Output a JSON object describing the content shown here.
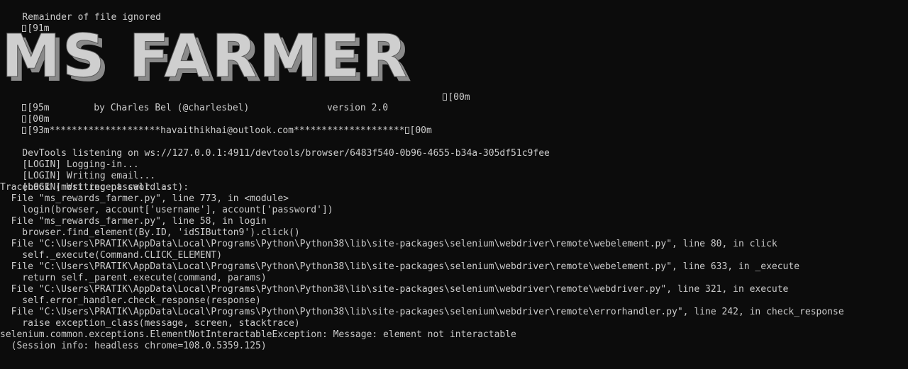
{
  "terminal": {
    "notice": "Remainder of file ignored",
    "ansi_red": "[91m",
    "banner_text": "MS FARMER",
    "ansi_reset_after_banner": "[00m",
    "credit_line": "[95m        by Charles Bel (@charlesbel)              version 2.0",
    "ansi_reset": "[00m",
    "account_line": "[93m********************havaithikhai@outlook.com********************",
    "account_line_reset": "[00m",
    "devtools_line": "DevTools listening on ws://127.0.0.1:4911/devtools/browser/6483f540-0b96-4655-b34a-305df51c9fee",
    "login_lines": [
      "[LOGIN] Logging-in...",
      "[LOGIN] Writing email...",
      "[LOGIN] Writing password..."
    ],
    "traceback_lines": [
      "Traceback (most recent call last):",
      "  File \"ms_rewards_farmer.py\", line 773, in <module>",
      "    login(browser, account['username'], account['password'])",
      "  File \"ms_rewards_farmer.py\", line 58, in login",
      "    browser.find_element(By.ID, 'idSIButton9').click()",
      "  File \"C:\\Users\\PRATIK\\AppData\\Local\\Programs\\Python\\Python38\\lib\\site-packages\\selenium\\webdriver\\remote\\webelement.py\", line 80, in click",
      "    self._execute(Command.CLICK_ELEMENT)",
      "  File \"C:\\Users\\PRATIK\\AppData\\Local\\Programs\\Python\\Python38\\lib\\site-packages\\selenium\\webdriver\\remote\\webelement.py\", line 633, in _execute",
      "    return self._parent.execute(command, params)",
      "  File \"C:\\Users\\PRATIK\\AppData\\Local\\Programs\\Python\\Python38\\lib\\site-packages\\selenium\\webdriver\\remote\\webdriver.py\", line 321, in execute",
      "    self.error_handler.check_response(response)",
      "  File \"C:\\Users\\PRATIK\\AppData\\Local\\Programs\\Python\\Python38\\lib\\site-packages\\selenium\\webdriver\\remote\\errorhandler.py\", line 242, in check_response",
      "    raise exception_class(message, screen, stacktrace)",
      "selenium.common.exceptions.ElementNotInteractableException: Message: element not interactable",
      "  (Session info: headless chrome=108.0.5359.125)"
    ],
    "colors": {
      "background": "#0c0c0c",
      "text": "#cccccc",
      "banner_face": "#cfcfcf",
      "banner_shadow": "#8a8a8a"
    }
  }
}
